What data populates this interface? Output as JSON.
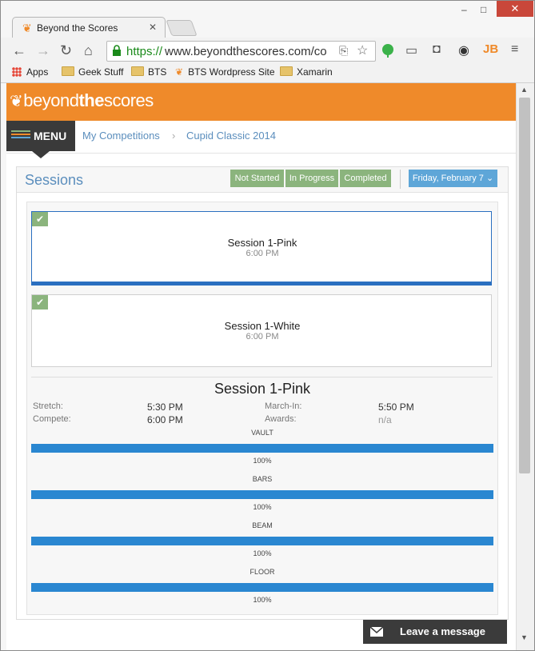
{
  "browser": {
    "tab_title": "Beyond the Scores",
    "url_scheme": "https://",
    "url_rest": "www.beyondthescores.com/co",
    "bookmarks": [
      {
        "label": "Apps"
      },
      {
        "label": "Geek Stuff"
      },
      {
        "label": "BTS"
      },
      {
        "label": "BTS Wordpress Site"
      },
      {
        "label": "Xamarin"
      }
    ],
    "extension_label": "JB"
  },
  "site": {
    "logo_light": "beyond",
    "logo_bold": "the",
    "logo_end": "scores",
    "brand_color": "#ef8a2a"
  },
  "nav": {
    "menu_label": "MENU",
    "breadcrumb": [
      "My Competitions",
      "Cupid Classic 2014"
    ]
  },
  "panel": {
    "title": "Sessions",
    "filters": [
      "Not Started",
      "In Progress",
      "Completed"
    ],
    "date_label": "Friday, February 7"
  },
  "sessions": [
    {
      "name": "Session 1-Pink",
      "time": "6:00 PM",
      "selected": true
    },
    {
      "name": "Session 1-White",
      "time": "6:00 PM",
      "selected": false
    }
  ],
  "detail": {
    "title": "Session 1-Pink",
    "stretch_label": "Stretch:",
    "stretch_value": "5:30 PM",
    "compete_label": "Compete:",
    "compete_value": "6:00 PM",
    "march_label": "March-In:",
    "march_value": "5:50 PM",
    "awards_label": "Awards:",
    "awards_value": "n/a",
    "events": [
      {
        "name": "VAULT",
        "progress": 100,
        "label": "100%"
      },
      {
        "name": "BARS",
        "progress": 100,
        "label": "100%"
      },
      {
        "name": "BEAM",
        "progress": 100,
        "label": "100%"
      },
      {
        "name": "FLOOR",
        "progress": 100,
        "label": "100%"
      }
    ]
  },
  "chat": {
    "label": "Leave a message"
  }
}
